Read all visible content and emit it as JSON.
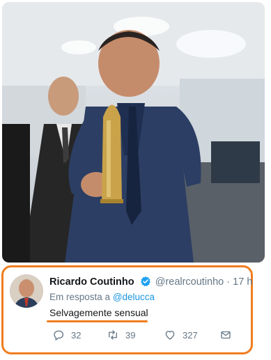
{
  "photo": {
    "alt_subject": "man-holding-bullet-object"
  },
  "tweet": {
    "display_name": "Ricardo Coutinho",
    "handle": "@realrcoutinho",
    "separator": "·",
    "time": "17 h",
    "reply_prefix": "Em resposta a",
    "reply_to": "@delucca",
    "text": "Selvagemente sensual",
    "actions": {
      "replies": "32",
      "retweets": "39",
      "likes": "327"
    },
    "verified_color": "#1da1f2",
    "highlight_color": "#f07d1e"
  }
}
